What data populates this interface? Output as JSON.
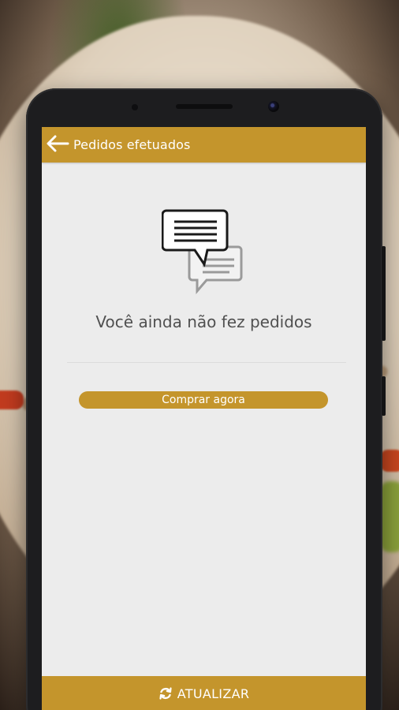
{
  "app_bar": {
    "back_icon": "arrow-left-icon",
    "title": "Pedidos efetuados"
  },
  "empty_state": {
    "icon": "chat-bubbles-icon",
    "message": "Você ainda não fez pedidos"
  },
  "actions": {
    "buy_now_label": "Comprar agora"
  },
  "bottom_bar": {
    "icon": "refresh-icon",
    "label": "ATUALIZAR"
  },
  "colors": {
    "accent": "#c4952c",
    "screen_bg": "#ececec",
    "text": "#505050"
  }
}
